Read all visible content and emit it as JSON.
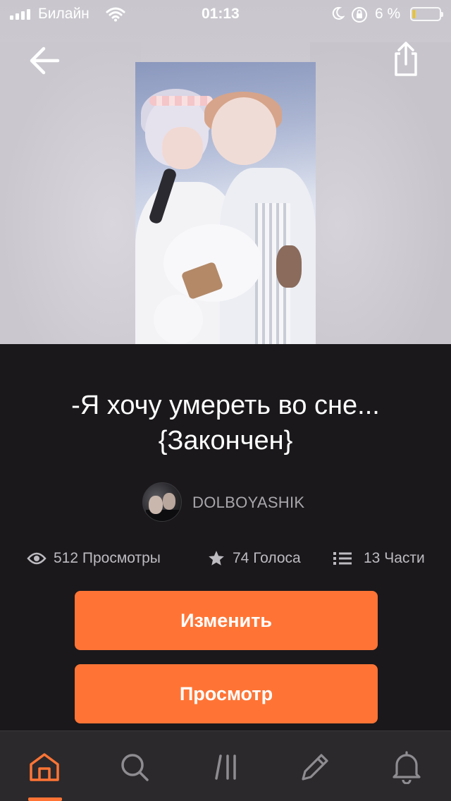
{
  "status_bar": {
    "carrier": "Билайн",
    "time": "01:13",
    "battery_percent": "6 %",
    "battery_level": 0.06
  },
  "nav": {
    "back_icon": "arrow-left-icon",
    "share_icon": "share-icon"
  },
  "story": {
    "title_line1": "-Я хочу умереть во сне...",
    "title_line2": "{Закончен}",
    "author": "DOLBOYASHIK"
  },
  "stats": {
    "views": "512 Просмотры",
    "votes": "74 Голоса",
    "parts": "13 Части"
  },
  "buttons": {
    "edit": "Изменить",
    "preview": "Просмотр"
  },
  "tabs": [
    {
      "icon": "home-icon",
      "active": true
    },
    {
      "icon": "search-icon",
      "active": false
    },
    {
      "icon": "library-icon",
      "active": false
    },
    {
      "icon": "pencil-icon",
      "active": false
    },
    {
      "icon": "bell-icon",
      "active": false
    }
  ],
  "colors": {
    "accent": "#ff7435",
    "background": "#1a181b",
    "tabbar": "#2b292c"
  }
}
